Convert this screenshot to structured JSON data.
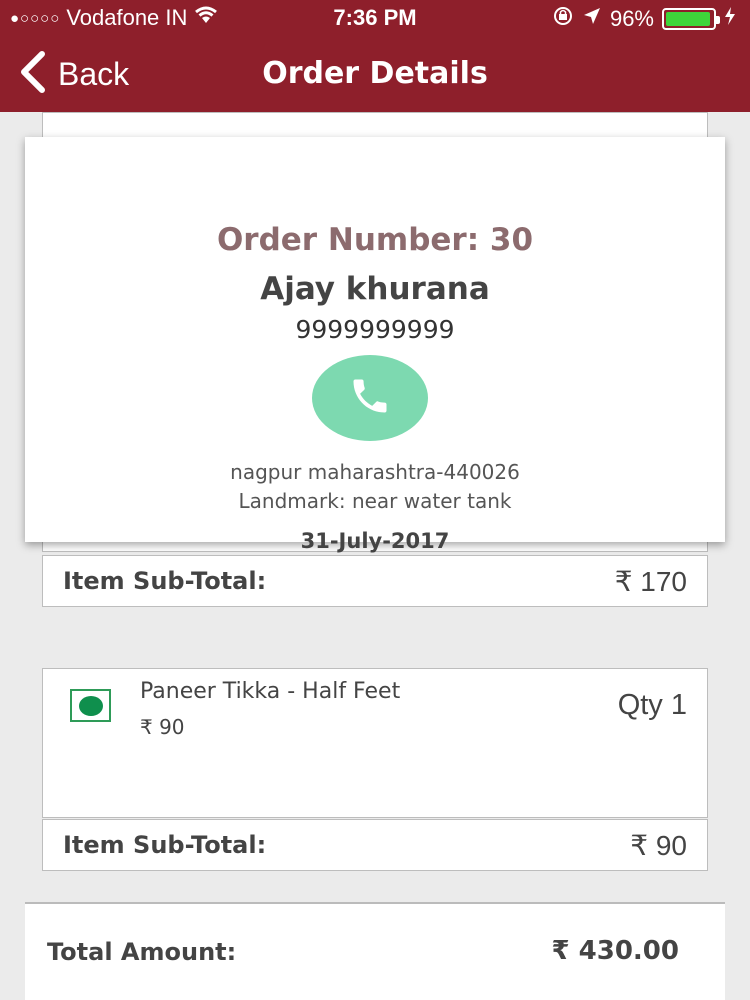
{
  "status_bar": {
    "signal": "●○○○○",
    "carrier": "Vodafone IN",
    "time": "7:36 PM",
    "battery": "96%",
    "battery_level": 0.96,
    "battery_color": "#3ed53a"
  },
  "nav": {
    "back_label": "Back",
    "title": "Order Details",
    "bar_color": "#8e1f2b"
  },
  "order": {
    "number_label": "Order Number: 30",
    "customer_name": "Ajay khurana",
    "phone": "9999999999",
    "call_icon": "phone-icon",
    "address": "nagpur  maharashtra-440026",
    "landmark": "Landmark: near water tank",
    "date": "31-July-2017"
  },
  "sections": [
    {
      "subtotal_label": "Item Sub-Total:",
      "subtotal_value": "₹ 170"
    },
    {
      "items": [
        {
          "name": "Paneer Tikka - Half Feet",
          "price": "₹ 90",
          "qty": "Qty 1",
          "veg_icon": "veg-indicator-icon"
        }
      ],
      "subtotal_label": "Item Sub-Total:",
      "subtotal_value": "₹ 90"
    }
  ],
  "total": {
    "label": "Total Amount:",
    "value": "₹ 430.00"
  }
}
